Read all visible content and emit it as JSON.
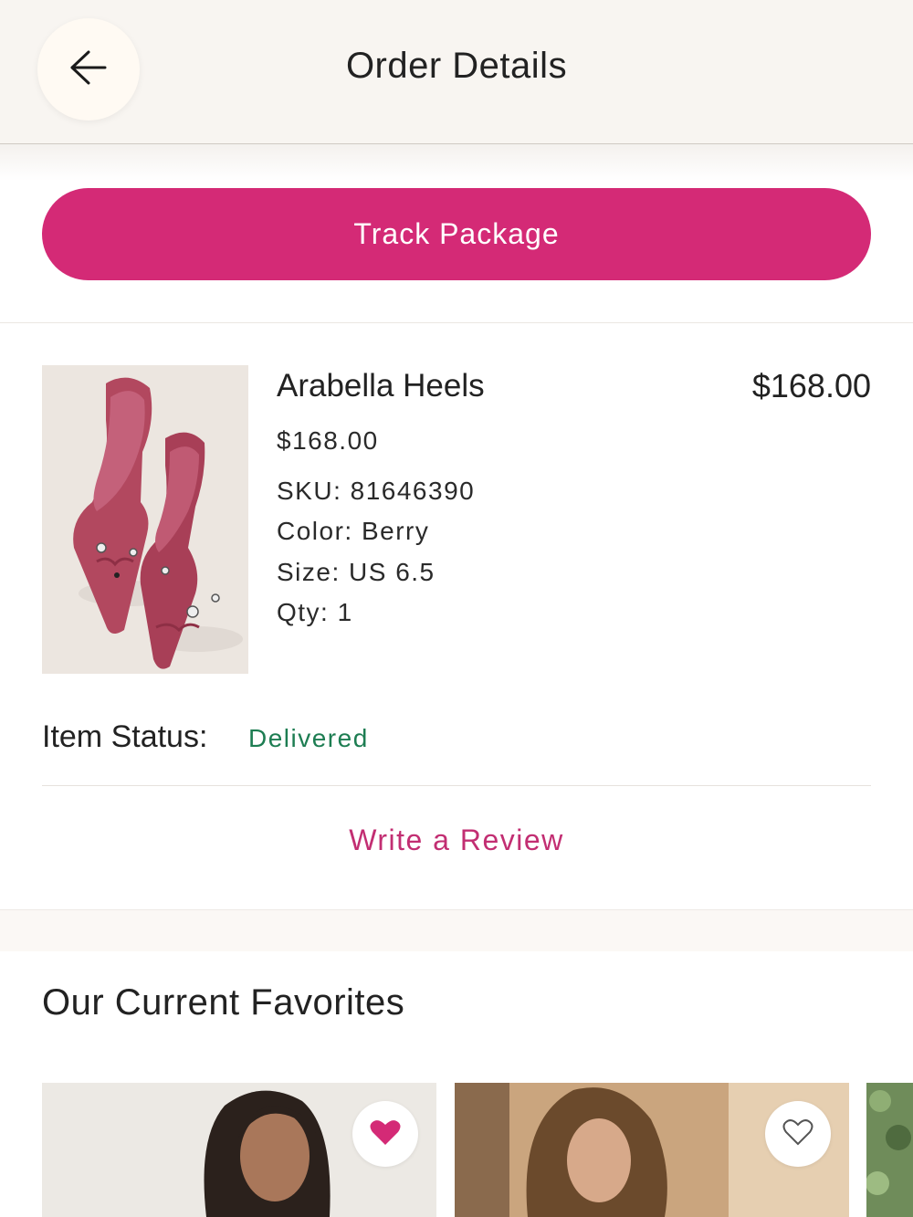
{
  "header": {
    "title": "Order Details",
    "back_icon": "arrow-left-icon"
  },
  "actions": {
    "track_label": "Track Package"
  },
  "item": {
    "name": "Arabella Heels",
    "line_total": "$168.00",
    "unit_price": "$168.00",
    "sku": "SKU: 81646390",
    "color": "Color: Berry",
    "size": "Size: US 6.5",
    "qty": "Qty: 1",
    "status_label": "Item Status:",
    "status_value": "Delivered",
    "review_label": "Write a Review"
  },
  "favorites": {
    "title": "Our Current Favorites",
    "cards": [
      {
        "favorited": true,
        "icon": "heart-filled-icon"
      },
      {
        "favorited": false,
        "icon": "heart-outline-icon"
      },
      {
        "favorited": false
      }
    ]
  },
  "colors": {
    "accent": "#d42a76",
    "status_green": "#1d7d52",
    "link_pink": "#c22e72",
    "header_bg": "#f8f5f1"
  }
}
